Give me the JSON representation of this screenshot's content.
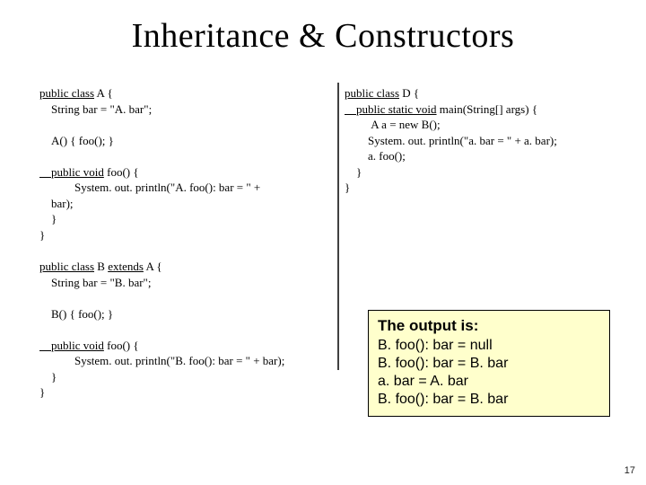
{
  "title": "Inheritance & Constructors",
  "left": {
    "classA": {
      "sig_pre": "public class",
      "sig_name": " A {",
      "field": "    String bar = \"A. bar\";",
      "ctor": "    A() { foo(); }",
      "foo_sig_pre": "    public void",
      "foo_sig_rest": " foo() {",
      "foo_body": "            System. out. println(\"A. foo(): bar = \" +\n    bar);\n    }",
      "close": "}"
    },
    "classB": {
      "sig_pre": "public class",
      "sig_name": " B ",
      "sig_ext": "extends",
      "sig_rest": " A {",
      "field": "    String bar = \"B. bar\";",
      "ctor": "    B() { foo(); }",
      "foo_sig_pre": "    public void",
      "foo_sig_rest": " foo() {",
      "foo_body": "            System. out. println(\"B. foo(): bar = \" + bar);\n    }",
      "close": "}"
    }
  },
  "right": {
    "classD": {
      "sig_pre": "public class",
      "sig_name": " D {",
      "main_pre": "    public static void",
      "main_rest": " main(String[] args) {",
      "body1": "         A a = new B();",
      "body2": "        System. out. println(\"a. bar = \" + a. bar);",
      "body3": "        a. foo();",
      "close_main": "    }",
      "close": "}"
    }
  },
  "output": {
    "header": "The output is:",
    "lines": [
      "B. foo(): bar = null",
      "B. foo(): bar = B. bar",
      "a. bar = A. bar",
      "B. foo(): bar = B. bar"
    ]
  },
  "page": "17"
}
